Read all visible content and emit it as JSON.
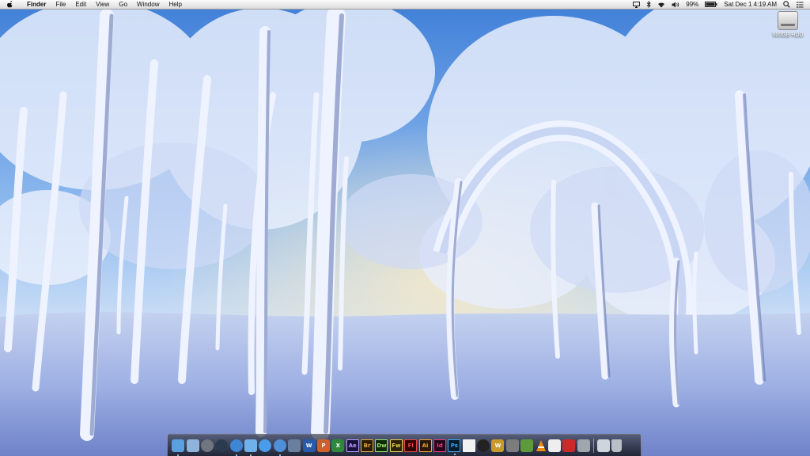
{
  "menubar": {
    "app_name": "Finder",
    "menus": [
      "File",
      "Edit",
      "View",
      "Go",
      "Window",
      "Help"
    ],
    "status": {
      "battery": "99%",
      "clock": "Sat Dec 1  4:19 AM"
    }
  },
  "desktop": {
    "drive_label": "500GB HDD"
  },
  "dock": {
    "items": [
      {
        "name": "finder",
        "label": "",
        "color": "#5a9fe0"
      },
      {
        "name": "preview",
        "label": "",
        "color": "#8fb4d9"
      },
      {
        "name": "system-preferences",
        "label": "",
        "color": "#6f7680"
      },
      {
        "name": "world-of-warcraft",
        "label": "",
        "color": "#2b3b4f"
      },
      {
        "name": "safari",
        "label": "",
        "color": "#3d86d6"
      },
      {
        "name": "messages",
        "label": "",
        "color": "#6fb2ea"
      },
      {
        "name": "app-store",
        "label": "",
        "color": "#4a9be8"
      },
      {
        "name": "itunes",
        "label": "",
        "color": "#4f8fd8"
      },
      {
        "name": "xcode",
        "label": "",
        "color": "#6a7fa0"
      },
      {
        "name": "word",
        "label": "W",
        "color": "#2a5aa8"
      },
      {
        "name": "powerpoint",
        "label": "P",
        "color": "#d0602a"
      },
      {
        "name": "excel",
        "label": "X",
        "color": "#2e8a3a"
      },
      {
        "name": "after-effects",
        "label": "Ae",
        "color": "#1a1040",
        "accent": "#b59cff"
      },
      {
        "name": "bridge",
        "label": "Br",
        "color": "#2a1d05",
        "accent": "#e5a93b"
      },
      {
        "name": "dreamweaver",
        "label": "Dw",
        "color": "#0e2a06",
        "accent": "#9de26a"
      },
      {
        "name": "fireworks",
        "label": "Fw",
        "color": "#2a2205",
        "accent": "#e8d44a"
      },
      {
        "name": "flash",
        "label": "Fl",
        "color": "#300404",
        "accent": "#e8464a"
      },
      {
        "name": "illustrator",
        "label": "Ai",
        "color": "#2b1603",
        "accent": "#f7a235"
      },
      {
        "name": "indesign",
        "label": "Id",
        "color": "#2a0418",
        "accent": "#ea3c8b"
      },
      {
        "name": "photoshop",
        "label": "Ps",
        "color": "#041a2e",
        "accent": "#3ca6ea"
      },
      {
        "name": "acrobat",
        "label": "",
        "color": "#f2f2f2"
      },
      {
        "name": "dvd-player",
        "label": "",
        "color": "#222"
      },
      {
        "name": "warcraft",
        "label": "W",
        "color": "#c79a2a"
      },
      {
        "name": "disk-utility",
        "label": "",
        "color": "#7c7c7c"
      },
      {
        "name": "minecraft",
        "label": "",
        "color": "#5f9a3a"
      },
      {
        "name": "vlc",
        "label": "",
        "color": "#f08a12"
      },
      {
        "name": "calendar",
        "label": "",
        "color": "#eeeeee"
      },
      {
        "name": "photo-booth",
        "label": "",
        "color": "#c92a2a"
      },
      {
        "name": "screenshot",
        "label": "",
        "color": "#a0a6ad"
      }
    ],
    "right_items": [
      {
        "name": "documents-stack",
        "color": "#cfd5dc"
      },
      {
        "name": "trash",
        "color": "#b9bfc6"
      }
    ]
  }
}
